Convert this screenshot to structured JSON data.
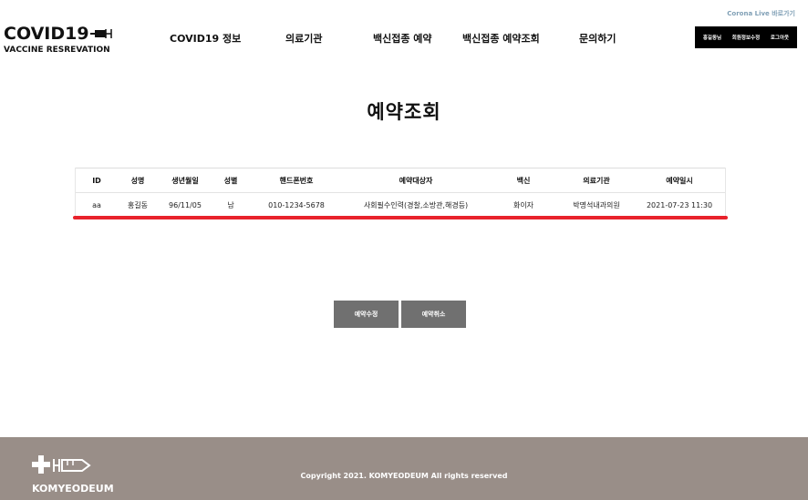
{
  "header": {
    "top_link": "Corona Live 바로가기",
    "logo_title": "COVID19",
    "logo_subtitle": "VACCINE RESREVATION",
    "nav": [
      "COVID19 정보",
      "의료기관",
      "백신접종 예약",
      "백신접종 예약조회",
      "문의하기"
    ],
    "user_menu": {
      "user": "홍길동님",
      "edit_profile": "회원정보수정",
      "logout": "로그아웃"
    }
  },
  "main": {
    "title": "예약조회",
    "table": {
      "headers": [
        "ID",
        "성명",
        "생년월일",
        "성별",
        "핸드폰번호",
        "예약대상자",
        "백신",
        "의료기관",
        "예약일시"
      ],
      "rows": [
        [
          "aa",
          "홍길동",
          "96/11/05",
          "남",
          "010-1234-5678",
          "사회필수인력(경찰,소방관,해경등)",
          "화이자",
          "박명석내과의원",
          "2021-07-23 11:30"
        ]
      ]
    },
    "buttons": {
      "edit": "예약수정",
      "cancel": "예약취소"
    }
  },
  "footer": {
    "logo_text": "KOMYEODEUM",
    "copyright": "Copyright 2021. KOMYEODEUM All rights reserved"
  },
  "colors": {
    "accent_red": "#e8222b",
    "button_gray": "#707070",
    "footer_bg": "#998e88"
  },
  "icons": {
    "logo": "syringe-icon",
    "footer_logo": "cross-syringe-icon"
  }
}
